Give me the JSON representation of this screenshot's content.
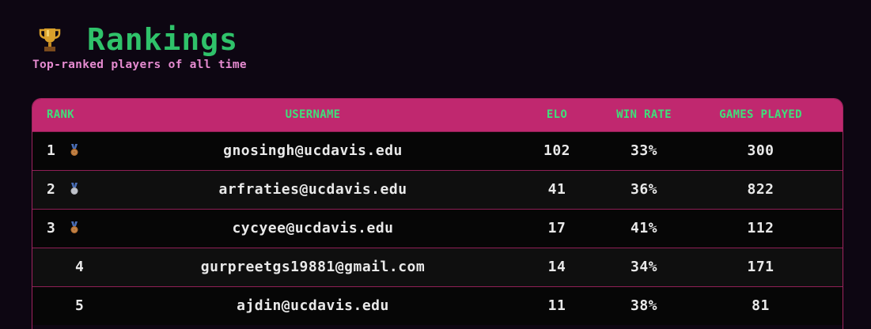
{
  "header": {
    "trophy_icon": "trophy-icon",
    "title": "Rankings",
    "subtitle": "Top-ranked players of all time"
  },
  "table": {
    "columns": {
      "rank": "RANK",
      "username": "USERNAME",
      "elo": "ELO",
      "win_rate": "WIN RATE",
      "games_played": "GAMES PLAYED"
    },
    "rows": [
      {
        "rank": "1",
        "medal": "bronze-medal-icon",
        "username": "gnosingh@ucdavis.edu",
        "elo": "102",
        "win_rate": "33%",
        "games_played": "300"
      },
      {
        "rank": "2",
        "medal": "silver-medal-icon",
        "username": "arfraties@ucdavis.edu",
        "elo": "41",
        "win_rate": "36%",
        "games_played": "822"
      },
      {
        "rank": "3",
        "medal": "bronze-medal-icon",
        "username": "cycyee@ucdavis.edu",
        "elo": "17",
        "win_rate": "41%",
        "games_played": "112"
      },
      {
        "rank": "4",
        "medal": "",
        "username": "gurpreetgs19881@gmail.com",
        "elo": "14",
        "win_rate": "34%",
        "games_played": "171"
      },
      {
        "rank": "5",
        "medal": "",
        "username": "ajdin@ucdavis.edu",
        "elo": "11",
        "win_rate": "38%",
        "games_played": "81"
      }
    ]
  },
  "colors": {
    "background": "#0d0612",
    "title": "#2fc26a",
    "subtitle": "#e58bd0",
    "header_row": "#c0286f",
    "header_text": "#3ee07a",
    "row_border": "#8e1f55",
    "cell_text": "#e9e9e9"
  }
}
